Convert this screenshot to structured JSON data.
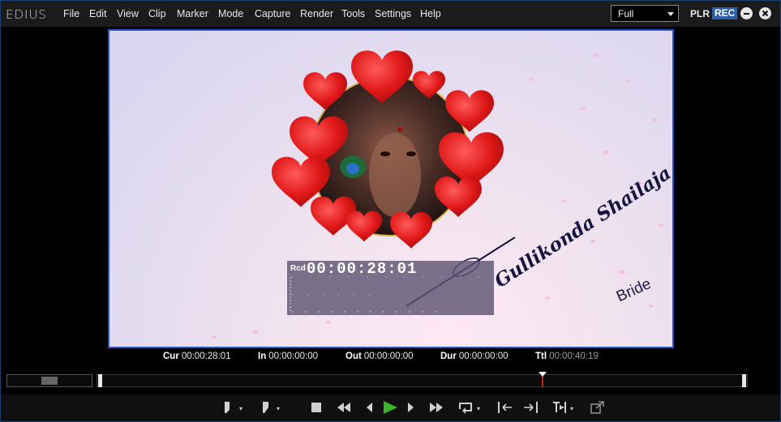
{
  "app": {
    "name": "EDIUS"
  },
  "menu": [
    "File",
    "Edit",
    "View",
    "Clip",
    "Marker",
    "Mode",
    "Capture",
    "Render",
    "Tools",
    "Settings",
    "Help"
  ],
  "view_select": {
    "value": "Full"
  },
  "window": {
    "plr": "PLR",
    "rec": "REC"
  },
  "preview": {
    "overlay_text": "Gullikonda Shailaja",
    "overlay_sub": "Bride",
    "timecode_label": "Rcd",
    "timecode": "00:00:28:01"
  },
  "info": {
    "cur_label": "Cur",
    "cur": "00:00:28:01",
    "in_label": "In",
    "in": "00:00:00:00",
    "out_label": "Out",
    "out": "00:00:00:00",
    "dur_label": "Dur",
    "dur": "00:00:00:00",
    "ttl_label": "Ttl",
    "ttl": "00:00:40:19"
  },
  "timeline": {
    "playhead_fraction": 0.7
  },
  "colors": {
    "accent": "#2a52c5",
    "rec_badge": "#2d5fa8",
    "play": "#3cb32c",
    "playhead": "#cc2211"
  },
  "transport_icons": [
    "set-in-icon",
    "set-out-icon",
    "stop-icon",
    "rewind-icon",
    "step-back-icon",
    "play-icon",
    "step-forward-icon",
    "fast-forward-icon",
    "loop-icon",
    "go-in-icon",
    "go-out-icon",
    "insert-icon",
    "export-icon"
  ]
}
